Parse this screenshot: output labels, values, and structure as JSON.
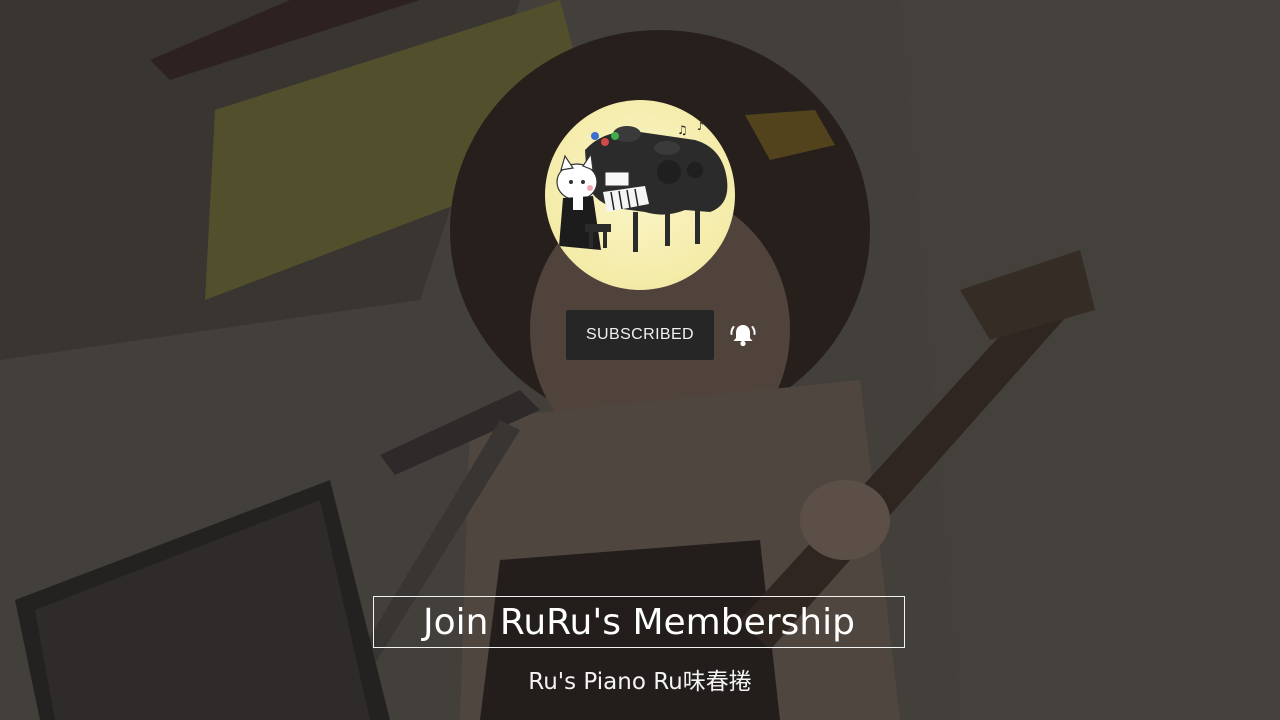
{
  "channel": {
    "avatar_icon": "cat-playing-gamepad-piano-logo",
    "name": "Ru's Piano Ru味春捲"
  },
  "subscribe": {
    "button_label": "SUBSCRIBED",
    "bell_icon": "bell-ring-icon"
  },
  "membership": {
    "cta_label": "Join RuRu's Membership"
  },
  "colors": {
    "button_bg": "#262626",
    "text": "#ffffff",
    "avatar_bg": "#f4eba8"
  }
}
